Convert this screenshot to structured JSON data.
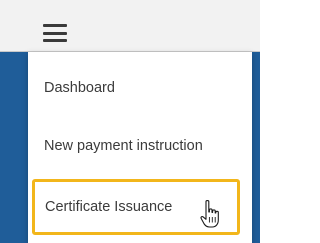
{
  "header": {
    "menu_icon": "hamburger-menu-icon"
  },
  "menu": {
    "items": [
      {
        "label": "Dashboard"
      },
      {
        "label": "New payment instruction"
      },
      {
        "label": "Certificate Issuance",
        "highlighted": true
      }
    ]
  },
  "pointer": {
    "icon": "hand-pointer-cursor-icon"
  },
  "colors": {
    "highlight_border": "#f2b61b",
    "sidebar_blue": "#1f5d99",
    "topbar_bg": "#f2f2f2",
    "menu_text": "#3b3b3b"
  }
}
